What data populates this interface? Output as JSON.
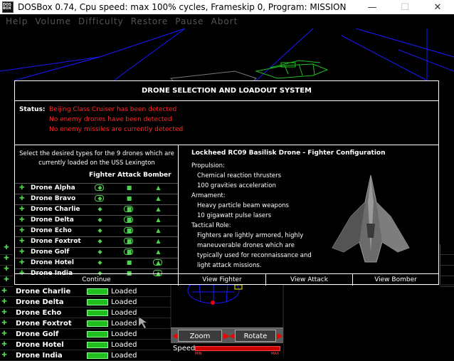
{
  "window": {
    "icon_text": "DOS BOX",
    "title": "DOSBox 0.74, Cpu speed: max 100% cycles, Frameskip  0, Program:  MISSION",
    "minimize": "—",
    "maximize": "☐",
    "close": "✕"
  },
  "dos_menu": [
    "Help",
    "Volume",
    "Difficulty",
    "Restore",
    "Pause",
    "Abort"
  ],
  "dialog": {
    "title": "DRONE SELECTION AND LOADOUT SYSTEM",
    "status_label": "Status:",
    "status_lines": [
      "Beijing Class Cruiser has been detected",
      "No enemy drones have been detected",
      "No enemy missiles are currently detected"
    ],
    "instruction": "Select the desired types for the 9 drones which are currently loaded on the USS Lexington",
    "column_headers": "Fighter Attack Bomber",
    "drones": [
      {
        "name": "Drone Alpha",
        "selected": "fighter"
      },
      {
        "name": "Drone Bravo",
        "selected": "fighter"
      },
      {
        "name": "Drone Charlie",
        "selected": "attack"
      },
      {
        "name": "Drone Delta",
        "selected": "attack"
      },
      {
        "name": "Drone Echo",
        "selected": "attack"
      },
      {
        "name": "Drone Foxtrot",
        "selected": "attack"
      },
      {
        "name": "Drone Golf",
        "selected": "attack"
      },
      {
        "name": "Drone Hotel",
        "selected": "bomber"
      },
      {
        "name": "Drone India",
        "selected": "bomber"
      }
    ],
    "detail_heading": "Lockheed RC09 Basilisk Drone - Fighter Configuration",
    "specs": [
      {
        "text": "Propulsion:",
        "indent": false
      },
      {
        "text": "Chemical reaction thrusters",
        "indent": true
      },
      {
        "text": "100 gravities acceleration",
        "indent": true
      },
      {
        "text": "Armament:",
        "indent": false
      },
      {
        "text": "Heavy particle beam weapons",
        "indent": true
      },
      {
        "text": "10 gigawatt pulse lasers",
        "indent": true
      },
      {
        "text": "Tactical Role:",
        "indent": false
      },
      {
        "text": "Fighters are lightly armored, highly",
        "indent": true
      },
      {
        "text": "maneuverable drones which are",
        "indent": true
      },
      {
        "text": "typically used for reconnaissance and",
        "indent": true
      },
      {
        "text": "light attack missions.",
        "indent": true
      }
    ],
    "buttons": {
      "continue": "Continue",
      "view_fighter": "View Fighter",
      "view_attack": "View Attack",
      "view_bomber": "View Bomber"
    }
  },
  "hud_list": [
    {
      "name": "Drone Charlie",
      "status": "Loaded"
    },
    {
      "name": "Drone Delta",
      "status": "Loaded"
    },
    {
      "name": "Drone Echo",
      "status": "Loaded"
    },
    {
      "name": "Drone Foxtrot",
      "status": "Loaded"
    },
    {
      "name": "Drone Golf",
      "status": "Loaded"
    },
    {
      "name": "Drone Hotel",
      "status": "Loaded"
    },
    {
      "name": "Drone India",
      "status": "Loaded"
    }
  ],
  "controls": {
    "zoom": "Zoom",
    "rotate": "Rotate",
    "speed_label": "Speed:",
    "speed_min": "MIN",
    "speed_max": "MAX"
  },
  "colors": {
    "status_red": "#ff2a2a",
    "drone_green": "#4fd14f",
    "wireframe_blue": "#1a1aff",
    "wireframe_green": "#1fbf1f"
  }
}
